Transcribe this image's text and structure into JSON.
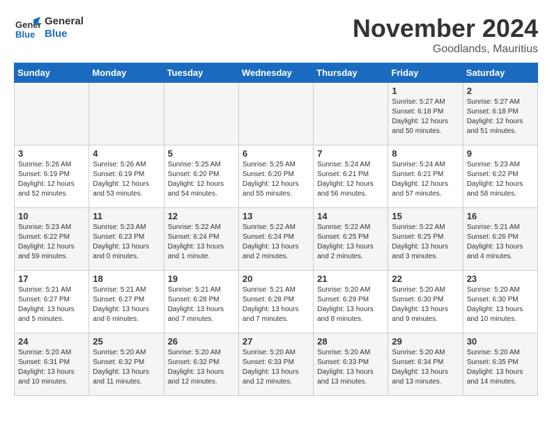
{
  "logo": {
    "line1": "General",
    "line2": "Blue"
  },
  "title": "November 2024",
  "subtitle": "Goodlands, Mauritius",
  "days_header": [
    "Sunday",
    "Monday",
    "Tuesday",
    "Wednesday",
    "Thursday",
    "Friday",
    "Saturday"
  ],
  "weeks": [
    [
      {
        "day": "",
        "info": ""
      },
      {
        "day": "",
        "info": ""
      },
      {
        "day": "",
        "info": ""
      },
      {
        "day": "",
        "info": ""
      },
      {
        "day": "",
        "info": ""
      },
      {
        "day": "1",
        "info": "Sunrise: 5:27 AM\nSunset: 6:18 PM\nDaylight: 12 hours\nand 50 minutes."
      },
      {
        "day": "2",
        "info": "Sunrise: 5:27 AM\nSunset: 6:18 PM\nDaylight: 12 hours\nand 51 minutes."
      }
    ],
    [
      {
        "day": "3",
        "info": "Sunrise: 5:26 AM\nSunset: 6:19 PM\nDaylight: 12 hours\nand 52 minutes."
      },
      {
        "day": "4",
        "info": "Sunrise: 5:26 AM\nSunset: 6:19 PM\nDaylight: 12 hours\nand 53 minutes."
      },
      {
        "day": "5",
        "info": "Sunrise: 5:25 AM\nSunset: 6:20 PM\nDaylight: 12 hours\nand 54 minutes."
      },
      {
        "day": "6",
        "info": "Sunrise: 5:25 AM\nSunset: 6:20 PM\nDaylight: 12 hours\nand 55 minutes."
      },
      {
        "day": "7",
        "info": "Sunrise: 5:24 AM\nSunset: 6:21 PM\nDaylight: 12 hours\nand 56 minutes."
      },
      {
        "day": "8",
        "info": "Sunrise: 5:24 AM\nSunset: 6:21 PM\nDaylight: 12 hours\nand 57 minutes."
      },
      {
        "day": "9",
        "info": "Sunrise: 5:23 AM\nSunset: 6:22 PM\nDaylight: 12 hours\nand 58 minutes."
      }
    ],
    [
      {
        "day": "10",
        "info": "Sunrise: 5:23 AM\nSunset: 6:22 PM\nDaylight: 12 hours\nand 59 minutes."
      },
      {
        "day": "11",
        "info": "Sunrise: 5:23 AM\nSunset: 6:23 PM\nDaylight: 13 hours\nand 0 minutes."
      },
      {
        "day": "12",
        "info": "Sunrise: 5:22 AM\nSunset: 6:24 PM\nDaylight: 13 hours\nand 1 minute."
      },
      {
        "day": "13",
        "info": "Sunrise: 5:22 AM\nSunset: 6:24 PM\nDaylight: 13 hours\nand 2 minutes."
      },
      {
        "day": "14",
        "info": "Sunrise: 5:22 AM\nSunset: 6:25 PM\nDaylight: 13 hours\nand 2 minutes."
      },
      {
        "day": "15",
        "info": "Sunrise: 5:22 AM\nSunset: 6:25 PM\nDaylight: 13 hours\nand 3 minutes."
      },
      {
        "day": "16",
        "info": "Sunrise: 5:21 AM\nSunset: 6:26 PM\nDaylight: 13 hours\nand 4 minutes."
      }
    ],
    [
      {
        "day": "17",
        "info": "Sunrise: 5:21 AM\nSunset: 6:27 PM\nDaylight: 13 hours\nand 5 minutes."
      },
      {
        "day": "18",
        "info": "Sunrise: 5:21 AM\nSunset: 6:27 PM\nDaylight: 13 hours\nand 6 minutes."
      },
      {
        "day": "19",
        "info": "Sunrise: 5:21 AM\nSunset: 6:28 PM\nDaylight: 13 hours\nand 7 minutes."
      },
      {
        "day": "20",
        "info": "Sunrise: 5:21 AM\nSunset: 6:28 PM\nDaylight: 13 hours\nand 7 minutes."
      },
      {
        "day": "21",
        "info": "Sunrise: 5:20 AM\nSunset: 6:29 PM\nDaylight: 13 hours\nand 8 minutes."
      },
      {
        "day": "22",
        "info": "Sunrise: 5:20 AM\nSunset: 6:30 PM\nDaylight: 13 hours\nand 9 minutes."
      },
      {
        "day": "23",
        "info": "Sunrise: 5:20 AM\nSunset: 6:30 PM\nDaylight: 13 hours\nand 10 minutes."
      }
    ],
    [
      {
        "day": "24",
        "info": "Sunrise: 5:20 AM\nSunset: 6:31 PM\nDaylight: 13 hours\nand 10 minutes."
      },
      {
        "day": "25",
        "info": "Sunrise: 5:20 AM\nSunset: 6:32 PM\nDaylight: 13 hours\nand 11 minutes."
      },
      {
        "day": "26",
        "info": "Sunrise: 5:20 AM\nSunset: 6:32 PM\nDaylight: 13 hours\nand 12 minutes."
      },
      {
        "day": "27",
        "info": "Sunrise: 5:20 AM\nSunset: 6:33 PM\nDaylight: 13 hours\nand 12 minutes."
      },
      {
        "day": "28",
        "info": "Sunrise: 5:20 AM\nSunset: 6:33 PM\nDaylight: 13 hours\nand 13 minutes."
      },
      {
        "day": "29",
        "info": "Sunrise: 5:20 AM\nSunset: 6:34 PM\nDaylight: 13 hours\nand 13 minutes."
      },
      {
        "day": "30",
        "info": "Sunrise: 5:20 AM\nSunset: 6:35 PM\nDaylight: 13 hours\nand 14 minutes."
      }
    ]
  ]
}
